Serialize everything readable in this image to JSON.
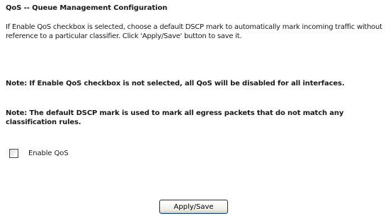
{
  "page": {
    "title": "QoS -- Queue Management Configuration",
    "description": "If Enable QoS checkbox is selected, choose a default DSCP mark to automatically mark incoming traffic without reference to a particular classifier. Click 'Apply/Save' button to save it.",
    "note_disable": "Note: If Enable QoS checkbox is not selected, all QoS will be disabled for all interfaces.",
    "note_dscp": "Note: The default DSCP mark is used to mark all egress packets that do not match any classification rules."
  },
  "form": {
    "enable_qos_label": "Enable QoS",
    "enable_qos_checked": false,
    "apply_button_label": "Apply/Save"
  }
}
